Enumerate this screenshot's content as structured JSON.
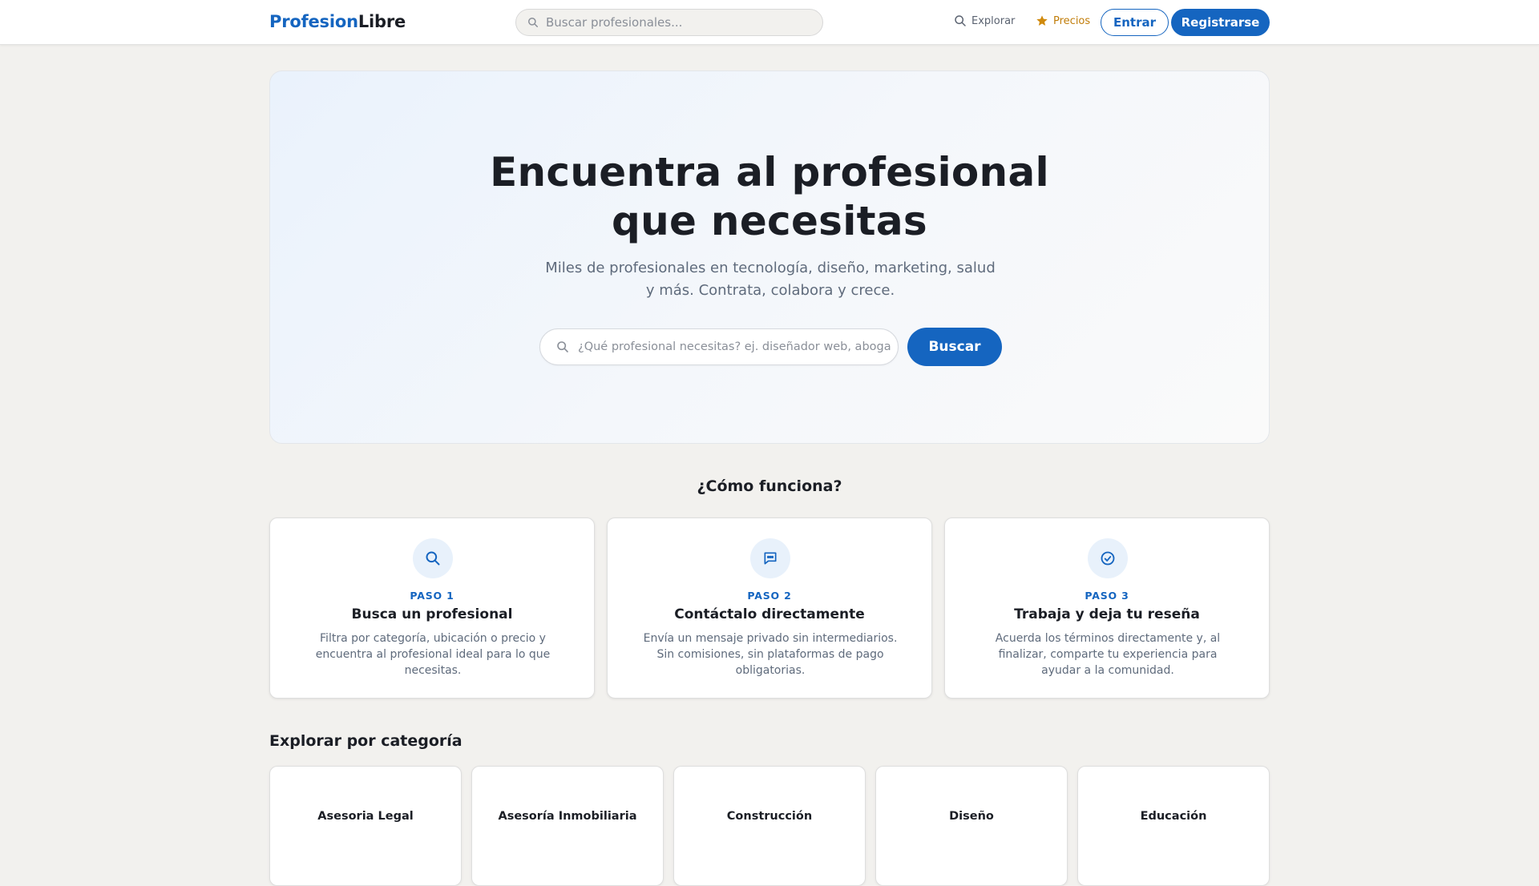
{
  "header": {
    "logo_part1": "Profesion",
    "logo_part2": "Libre",
    "search_placeholder": "Buscar profesionales...",
    "nav_explore": "Explorar",
    "nav_prices": "Precios",
    "login_label": "Entrar",
    "register_label": "Registrarse"
  },
  "hero": {
    "title_line1": "Encuentra al profesional",
    "title_line2": "que necesitas",
    "subtitle_line1": "Miles de profesionales en tecnología, diseño, marketing, salud",
    "subtitle_line2": "y más. Contrata, colabora y crece.",
    "search_placeholder": "¿Qué profesional necesitas? ej. diseñador web, abogado...",
    "search_button": "Buscar"
  },
  "how_it_works": {
    "title": "¿Cómo funciona?",
    "steps": [
      {
        "step": "PASO 1",
        "title": "Busca un profesional",
        "description": "Filtra por categoría, ubicación o precio y encuentra al profesional ideal para lo que necesitas.",
        "icon": "search-icon"
      },
      {
        "step": "PASO 2",
        "title": "Contáctalo directamente",
        "description": "Envía un mensaje privado sin intermediarios. Sin comisiones, sin plataformas de pago obligatorias.",
        "icon": "chat-icon"
      },
      {
        "step": "PASO 3",
        "title": "Trabaja y deja tu reseña",
        "description": "Acuerda los términos directamente y, al finalizar, comparte tu experiencia para ayudar a la comunidad.",
        "icon": "check-circle-icon"
      }
    ]
  },
  "categories": {
    "title": "Explorar por categoría",
    "items": [
      "Asesoria Legal",
      "Asesoría Inmobiliaria",
      "Construcción",
      "Diseño",
      "Educación"
    ]
  },
  "colors": {
    "brand": "#1565c0",
    "accent_gold": "#c17d0a",
    "background": "#f2f1ee"
  }
}
